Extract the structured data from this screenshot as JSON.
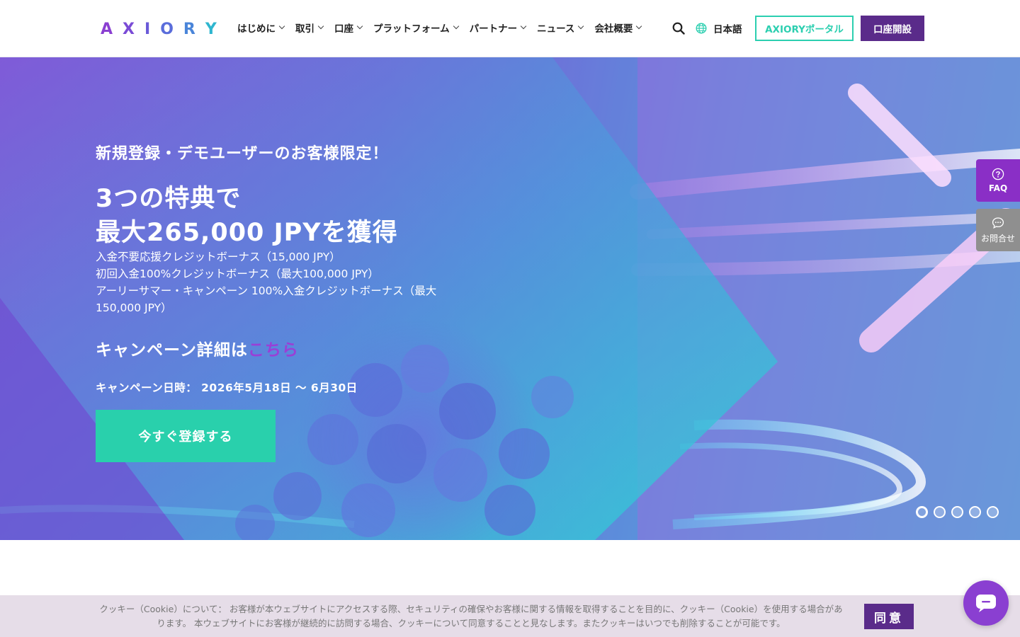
{
  "header": {
    "logo_text": "AXIORY",
    "nav": [
      {
        "label": "はじめに"
      },
      {
        "label": "取引"
      },
      {
        "label": "口座"
      },
      {
        "label": "プラットフォーム"
      },
      {
        "label": "パートナー"
      },
      {
        "label": "ニュース"
      },
      {
        "label": "会社概要"
      }
    ],
    "language": "日本語",
    "portal_button": "AXIORYポータル",
    "open_account_button": "口座開設"
  },
  "hero": {
    "subtitle": "新規登録・デモユーザーのお客様限定！",
    "title_line1": "3つの特典で",
    "title_line2": "最大265,000 JPYを獲得",
    "bonuses": [
      "入金不要応援クレジットボーナス（15,000 JPY）",
      "初回入金100%クレジットボーナス（最大100,000 JPY）",
      "アーリーサマー・キャンペーン 100%入金クレジットボーナス（最大150,000 JPY）"
    ],
    "campaign_detail_prefix": "キャンペーン詳細は",
    "campaign_detail_link": "こちら",
    "campaign_date": "キャンペーン日時： 2026年5月18日 〜 6月30日",
    "cta": "今すぐ登録する",
    "slide_count": 5,
    "active_slide": 1
  },
  "side": {
    "faq": "FAQ",
    "contact": "お問合せ"
  },
  "cookie": {
    "text": "クッキー（Cookie）について： お客様が本ウェブサイトにアクセスする際、セキュリティの確保やお客様に関する情報を取得することを目的に、クッキー（Cookie）を使用する場合があります。 本ウェブサイトにお客様が継続的に訪問する場合、クッキーについて同意することと見なします。またクッキーはいつでも削除することが可能です。",
    "agree": "同意"
  },
  "colors": {
    "brand_purple": "#5a2b8a",
    "accent_teal": "#29d0ac",
    "faq_purple": "#8a2fc6"
  }
}
